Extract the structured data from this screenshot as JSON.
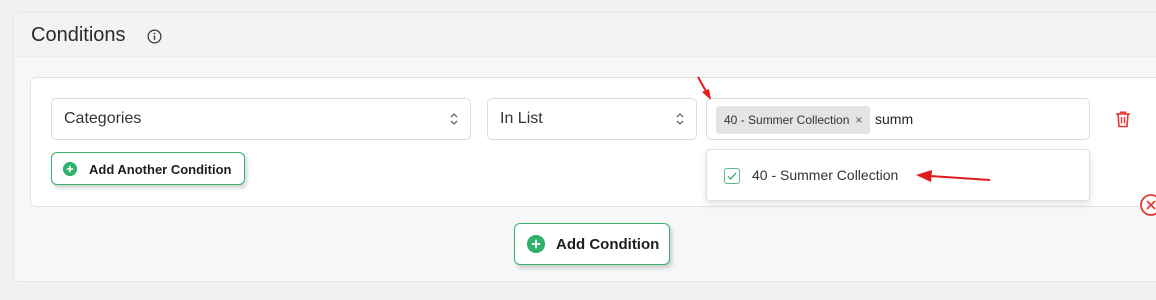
{
  "panel": {
    "title": "Conditions"
  },
  "condition": {
    "field_value": "Categories",
    "operator_value": "In List",
    "selected_tag": "40 - Summer Collection",
    "tag_remove_symbol": "×",
    "search_text": "summ"
  },
  "dropdown": {
    "options": [
      {
        "label": "40 - Summer Collection",
        "checked": true
      }
    ]
  },
  "buttons": {
    "add_another": "Add Another Condition",
    "add_condition": "Add Condition"
  },
  "colors": {
    "accent_green": "#2fb36a",
    "delete_red": "#e53935",
    "annotation_red": "#e01b1b"
  },
  "icons": [
    "info-icon",
    "chevron-updown-icon",
    "trash-icon",
    "plus-circle-icon",
    "checkbox-icon",
    "close-circle-icon",
    "annotation-arrow"
  ]
}
